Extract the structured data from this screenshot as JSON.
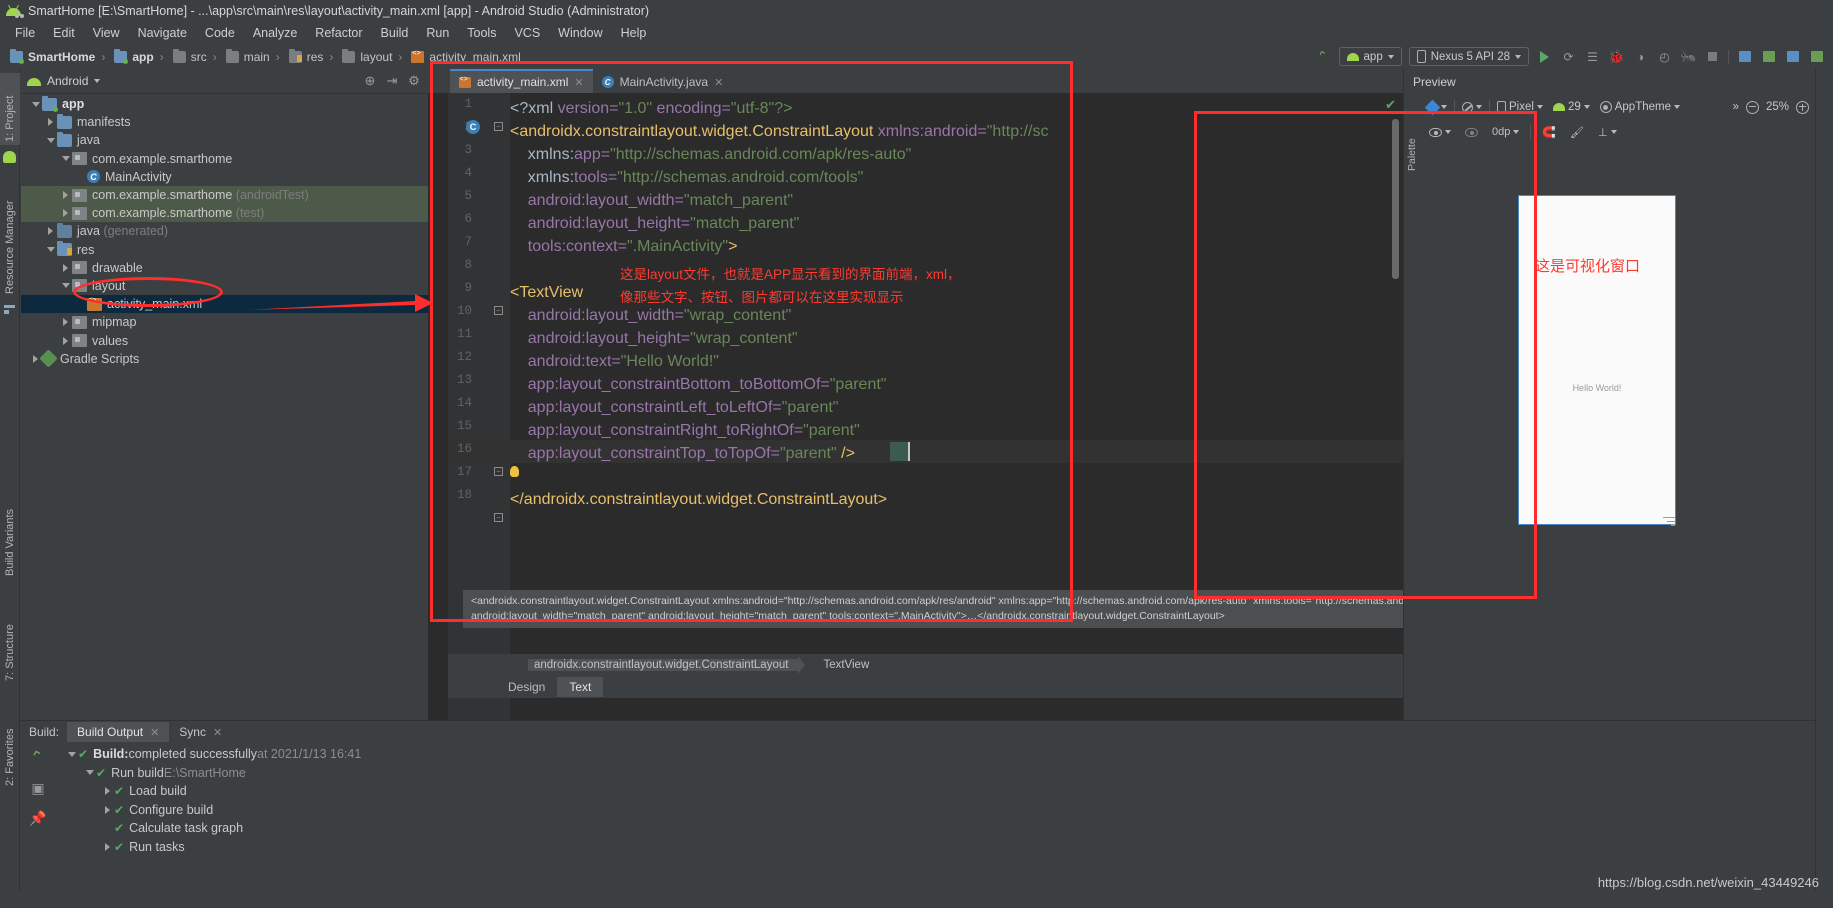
{
  "window": {
    "title": "SmartHome [E:\\SmartHome] - ...\\app\\src\\main\\res\\layout\\activity_main.xml [app] - Android Studio (Administrator)",
    "logo_icon": "android-logo-icon"
  },
  "menubar": {
    "items": [
      "File",
      "Edit",
      "View",
      "Navigate",
      "Code",
      "Analyze",
      "Refactor",
      "Build",
      "Run",
      "Tools",
      "VCS",
      "Window",
      "Help"
    ]
  },
  "breadcrumb": {
    "items": [
      {
        "label": "SmartHome",
        "icon": "folder-module-icon",
        "bold": true
      },
      {
        "label": "app",
        "icon": "folder-app-icon",
        "bold": true
      },
      {
        "label": "src",
        "icon": "folder-icon",
        "bold": false
      },
      {
        "label": "main",
        "icon": "folder-icon",
        "bold": false
      },
      {
        "label": "res",
        "icon": "folder-res-icon",
        "bold": false
      },
      {
        "label": "layout",
        "icon": "folder-package-icon",
        "bold": false
      },
      {
        "label": "activity_main.xml",
        "icon": "xml-file-icon",
        "bold": false
      }
    ]
  },
  "toolbar": {
    "module_selector": "app",
    "device_selector": "Nexus 5 API 28",
    "icons": [
      "build-hammer-icon",
      "run-icon",
      "attach-debugger-icon",
      "profile-list-icon",
      "debug-icon",
      "run-coverage-icon",
      "profiler-icon",
      "attach-process-icon",
      "stop-icon",
      "sdk-manager-icon",
      "avd-manager-icon",
      "sync-gradle-icon",
      "device-file-explorer-icon"
    ]
  },
  "project_panel": {
    "title": "Android",
    "header_icons": [
      "locate-icon",
      "collapse-all-icon",
      "settings-gear-icon"
    ],
    "tree": [
      {
        "depth": 0,
        "label": "app",
        "icon": "folder-module-icon",
        "twisty": "open",
        "bold": true,
        "state": "normal"
      },
      {
        "depth": 1,
        "label": "manifests",
        "icon": "folder-icon",
        "twisty": "closed",
        "bold": false,
        "state": "normal"
      },
      {
        "depth": 1,
        "label": "java",
        "icon": "folder-icon",
        "twisty": "open",
        "bold": false,
        "state": "normal"
      },
      {
        "depth": 2,
        "label": "com.example.smarthome",
        "icon": "package-icon",
        "twisty": "open",
        "bold": false,
        "state": "normal"
      },
      {
        "depth": 3,
        "label": "MainActivity",
        "icon": "java-class-icon",
        "twisty": "none",
        "bold": false,
        "state": "normal"
      },
      {
        "depth": 2,
        "label": "com.example.smarthome",
        "suffix": " (androidTest)",
        "icon": "package-icon",
        "twisty": "closed",
        "bold": false,
        "state": "highlight"
      },
      {
        "depth": 2,
        "label": "com.example.smarthome",
        "suffix": " (test)",
        "icon": "package-icon",
        "twisty": "closed",
        "bold": false,
        "state": "highlight"
      },
      {
        "depth": 1,
        "label": "java",
        "suffix": " (generated)",
        "icon": "folder-generated-icon",
        "twisty": "closed",
        "bold": false,
        "state": "normal"
      },
      {
        "depth": 1,
        "label": "res",
        "icon": "folder-res-icon",
        "twisty": "open",
        "bold": false,
        "state": "normal"
      },
      {
        "depth": 2,
        "label": "drawable",
        "icon": "package-icon",
        "twisty": "closed",
        "bold": false,
        "state": "normal"
      },
      {
        "depth": 2,
        "label": "layout",
        "icon": "package-icon",
        "twisty": "open",
        "bold": false,
        "state": "normal"
      },
      {
        "depth": 3,
        "label": "activity_main.xml",
        "icon": "xml-file-icon",
        "twisty": "none",
        "bold": false,
        "state": "selected"
      },
      {
        "depth": 2,
        "label": "mipmap",
        "icon": "package-icon",
        "twisty": "closed",
        "bold": false,
        "state": "normal"
      },
      {
        "depth": 2,
        "label": "values",
        "icon": "package-icon",
        "twisty": "closed",
        "bold": false,
        "state": "normal"
      },
      {
        "depth": 0,
        "label": "Gradle Scripts",
        "icon": "gradle-icon",
        "twisty": "closed",
        "bold": false,
        "state": "normal"
      }
    ]
  },
  "left_strips": {
    "top": [
      {
        "label": "1: Project",
        "icon": "project-icon",
        "selected": true
      },
      {
        "label": "Resource Manager",
        "icon": "resource-manager-icon",
        "selected": false
      }
    ],
    "bottom": [
      {
        "label": "Build Variants",
        "icon": "build-variants-icon"
      },
      {
        "label": "7: Structure",
        "icon": "structure-icon"
      },
      {
        "label": "2: Favorites",
        "icon": "favorites-icon"
      }
    ]
  },
  "editor": {
    "tabs": [
      {
        "label": "activity_main.xml",
        "icon": "xml-file-icon",
        "active": true
      },
      {
        "label": "MainActivity.java",
        "icon": "java-class-icon",
        "active": false
      }
    ],
    "lines": [
      {
        "n": 1,
        "segments": [
          {
            "t": "<?xml ",
            "c": "punct"
          },
          {
            "t": "version=",
            "c": "attr"
          },
          {
            "t": "\"1.0\"",
            "c": "val"
          },
          {
            "t": " encoding=",
            "c": "attr"
          },
          {
            "t": "\"utf-8\"?>",
            "c": "val"
          }
        ]
      },
      {
        "n": 2,
        "segments": [
          {
            "t": "<androidx.constraintlayout.widget.ConstraintLayout ",
            "c": "kw"
          },
          {
            "t": "xmlns:android=",
            "c": "attr"
          },
          {
            "t": "\"http://sc",
            "c": "val"
          }
        ]
      },
      {
        "n": 3,
        "segments": [
          {
            "t": "    xmlns:",
            "c": "punct"
          },
          {
            "t": "app=",
            "c": "attr"
          },
          {
            "t": "\"http://schemas.android.com/apk/res-auto\"",
            "c": "val"
          }
        ]
      },
      {
        "n": 4,
        "segments": [
          {
            "t": "    xmlns:",
            "c": "punct"
          },
          {
            "t": "tools=",
            "c": "attr"
          },
          {
            "t": "\"http://schemas.android.com/tools\"",
            "c": "val"
          }
        ]
      },
      {
        "n": 5,
        "segments": [
          {
            "t": "    android:layout_width=",
            "c": "attr"
          },
          {
            "t": "\"match_parent\"",
            "c": "val"
          }
        ]
      },
      {
        "n": 6,
        "segments": [
          {
            "t": "    android:layout_height=",
            "c": "attr"
          },
          {
            "t": "\"match_parent\"",
            "c": "val"
          }
        ]
      },
      {
        "n": 7,
        "segments": [
          {
            "t": "    tools:context=",
            "c": "attr"
          },
          {
            "t": "\".MainActivity\"",
            "c": "val"
          },
          {
            "t": ">",
            "c": "kw"
          }
        ]
      },
      {
        "n": 8,
        "segments": []
      },
      {
        "n": 9,
        "segments": [
          {
            "t": "<TextView",
            "c": "kw"
          }
        ]
      },
      {
        "n": 10,
        "segments": [
          {
            "t": "    android:layout_width=",
            "c": "attr"
          },
          {
            "t": "\"wrap_content\"",
            "c": "val"
          }
        ]
      },
      {
        "n": 11,
        "segments": [
          {
            "t": "    android:layout_height=",
            "c": "attr"
          },
          {
            "t": "\"wrap_content\"",
            "c": "val"
          }
        ]
      },
      {
        "n": 12,
        "segments": [
          {
            "t": "    android:text=",
            "c": "attr"
          },
          {
            "t": "\"Hello World!\"",
            "c": "val"
          }
        ]
      },
      {
        "n": 13,
        "segments": [
          {
            "t": "    app:layout_constraintBottom_toBottomOf=",
            "c": "attr"
          },
          {
            "t": "\"parent\"",
            "c": "val"
          }
        ]
      },
      {
        "n": 14,
        "segments": [
          {
            "t": "    app:layout_constraintLeft_toLeftOf=",
            "c": "attr"
          },
          {
            "t": "\"parent\"",
            "c": "val"
          }
        ]
      },
      {
        "n": 15,
        "segments": [
          {
            "t": "    app:layout_constraintRight_toRightOf=",
            "c": "attr"
          },
          {
            "t": "\"parent\"",
            "c": "val"
          }
        ]
      },
      {
        "n": 16,
        "segments": [
          {
            "t": "    app:layout_constraintTop_toTopOf=",
            "c": "attr"
          },
          {
            "t": "\"parent\"",
            "c": "val"
          },
          {
            "t": " />",
            "c": "kw"
          }
        ]
      },
      {
        "n": 17,
        "segments": []
      },
      {
        "n": 18,
        "segments": [
          {
            "t": "</androidx.constraintlayout.widget.ConstraintLayout>",
            "c": "kw"
          }
        ]
      }
    ],
    "annotation_line_1": "这是layout文件，也就是APP显示看到的界面前端，xml，",
    "annotation_line_2": "像那些文字、按钮、图片都可以在这里实现显示",
    "doc_tooltip_line1": "<androidx.constraintlayout.widget.ConstraintLayout xmlns:android=\"http://schemas.android.com/apk/res/android\" xmlns:app=\"http://schemas.android.com/apk/res-auto\" xmlns:tools=\"http://schemas.android.com/tools\"",
    "doc_tooltip_line2": "android:layout_width=\"match_parent\" android:layout_height=\"match_parent\" tools:context=\".MainActivity\">…</androidx.constraintlayout.widget.ConstraintLayout>",
    "structure_breadcrumb": [
      "androidx.constraintlayout.widget.ConstraintLayout",
      "TextView"
    ],
    "bottom_tabs": [
      {
        "label": "Design",
        "active": false
      },
      {
        "label": "Text",
        "active": true
      }
    ],
    "inspection_status": "ok-check-icon"
  },
  "preview": {
    "title": "Preview",
    "palette_tab": "Palette",
    "toolbar": {
      "design_mode": "design-surface-icon",
      "orientation": "orientation-icon",
      "device": "Pixel",
      "api_level": "29",
      "theme": "AppTheme",
      "overflow": "»",
      "zoom_level": "25%",
      "zoom_out_icon": "zoom-out-icon",
      "zoom_in_icon": "zoom-in-icon"
    },
    "toolbar2": {
      "visibility_icon": "eye-icon",
      "hide_icon": "eye-off-icon",
      "margin_value": "0dp",
      "icons": [
        "magnet-icon",
        "brush-icon",
        "baseline-icon"
      ]
    },
    "device_text": "Hello World!",
    "annotation": "这是可视化窗口"
  },
  "build_panel": {
    "label": "Build:",
    "tabs": [
      {
        "label": "Build Output",
        "active": true
      },
      {
        "label": "Sync",
        "active": false
      }
    ],
    "side_icons": [
      "rerun-build-icon",
      "toggle-tasks-icon",
      "pin-tab-icon"
    ],
    "tree": [
      {
        "depth": 0,
        "twisty": "open",
        "bold_part": "Build:",
        "text": " completed successfully",
        "muted": " at 2021/1/13 16:41"
      },
      {
        "depth": 1,
        "twisty": "open",
        "bold_part": "",
        "text": "Run build",
        "muted": " E:\\SmartHome"
      },
      {
        "depth": 2,
        "twisty": "closed",
        "bold_part": "",
        "text": "Load build",
        "muted": ""
      },
      {
        "depth": 2,
        "twisty": "closed",
        "bold_part": "",
        "text": "Configure build",
        "muted": ""
      },
      {
        "depth": 2,
        "twisty": "none",
        "bold_part": "",
        "text": "Calculate task graph",
        "muted": ""
      },
      {
        "depth": 2,
        "twisty": "closed",
        "bold_part": "",
        "text": "Run tasks",
        "muted": ""
      }
    ]
  },
  "watermark": "https://blog.csdn.net/weixin_43449246",
  "colors": {
    "annotation_red": "#ff2d2d",
    "editor_bg": "#2b2b2b",
    "panel_bg": "#3c3f41",
    "selection_blue": "#0d293e",
    "accent_blue": "#4a88c7",
    "success_green": "#59a869"
  }
}
